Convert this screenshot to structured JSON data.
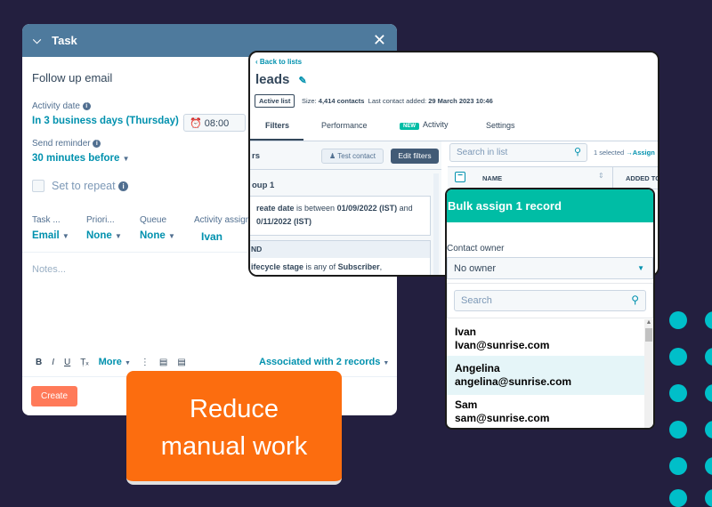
{
  "task": {
    "title": "Task",
    "name": "Follow up email",
    "activity_date_label": "Activity date",
    "activity_date_value": "In 3 business days (Thursday)",
    "time": "08:00",
    "reminder_label": "Send reminder",
    "reminder_value": "30 minutes before",
    "repeat_label": "Set to repeat",
    "cols": [
      {
        "label": "Task ...",
        "value": "Email"
      },
      {
        "label": "Priori...",
        "value": "None"
      },
      {
        "label": "Queue",
        "value": "None"
      },
      {
        "label": "Activity assign",
        "value": "Ivan"
      }
    ],
    "notes_placeholder": "Notes...",
    "toolbar_more": "More",
    "associated": "Associated with 2 records",
    "create": "Create"
  },
  "leads": {
    "back": "Back to lists",
    "title": "leads",
    "badge": "Active list",
    "size_label": "Size:",
    "size_value": "4,414 contacts",
    "last_added_label": "Last contact added:",
    "last_added_value": "29 March 2023 10:46",
    "tabs": [
      "Filters",
      "Performance",
      "Activity",
      "Settings"
    ],
    "new_badge": "NEW",
    "filters_title": "rs",
    "test_contact": "Test contact",
    "edit_filters": "Edit filters",
    "group_title": "oup 1",
    "cond1_a": "reate date",
    "cond1_b": " is between ",
    "cond1_c": "01/09/2022 (IST)",
    "cond1_d": " and ",
    "cond1_e": "0/11/2022 (IST)",
    "and": "ND",
    "cond2_a": "ifecycle stage",
    "cond2_b": " is any of ",
    "cond2_c": "Subscriber",
    "cond2_d": ",",
    "search_placeholder": "Search in list",
    "selected": "1 selected",
    "assign": "Assign",
    "col_name": "NAME",
    "col_added": "ADDED TO"
  },
  "bulk": {
    "title": "Bulk assign 1 record",
    "owner_label": "Contact owner",
    "owner_value": "No owner",
    "search_placeholder": "Search",
    "owners": [
      {
        "name": "Ivan",
        "email": "Ivan@sunrise.com"
      },
      {
        "name": "Angelina",
        "email": "angelina@sunrise.com"
      },
      {
        "name": "Sam",
        "email": "sam@sunrise.com"
      }
    ]
  },
  "banner": {
    "line1": "Reduce",
    "line2": "manual work"
  },
  "colors": {
    "background": "#231f3f",
    "accent_teal": "#00bda5",
    "link": "#0091ae",
    "banner": "#fc6d0f",
    "dots": "#00bfc9"
  }
}
